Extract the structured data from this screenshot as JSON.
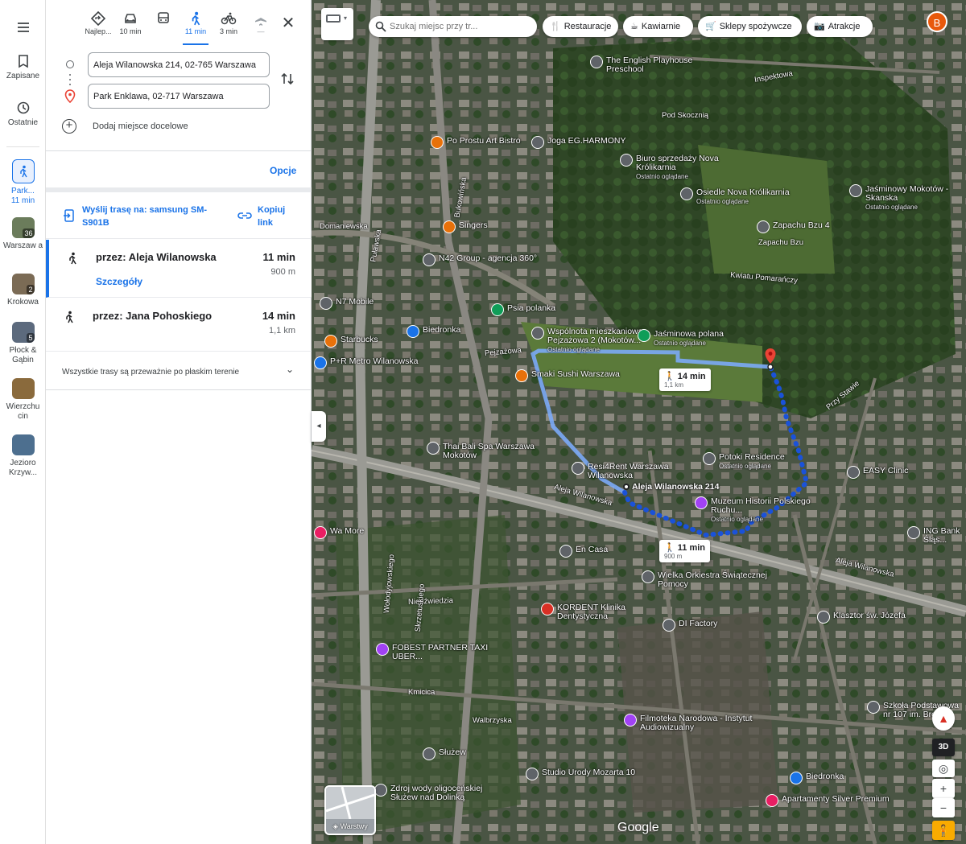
{
  "rail": {
    "menu_icon": "menu-icon",
    "saved_label": "Zapisane",
    "recent_label": "Ostatnie",
    "current": {
      "label": "Park...",
      "sub": "11 min"
    },
    "recents": [
      {
        "label": "Warszaw a",
        "badge": "36",
        "color": "#6b7c5b"
      },
      {
        "label": "Krokowa",
        "badge": "2",
        "color": "#7b6b55"
      },
      {
        "label": "Płock & Gąbin",
        "badge": "5",
        "color": "#5c6a7d"
      },
      {
        "label": "Wierzchu cin",
        "badge": "",
        "color": "#8a6a3c"
      },
      {
        "label": "Jezioro Krzyw...",
        "badge": "",
        "color": "#4d6f8f"
      }
    ]
  },
  "modes": [
    {
      "name": "best",
      "label": "Najlep...",
      "icon": "diamond-icon"
    },
    {
      "name": "car",
      "label": "10 min",
      "icon": "car-icon"
    },
    {
      "name": "transit",
      "label": "",
      "icon": "bus-icon"
    },
    {
      "name": "walk",
      "label": "11 min",
      "icon": "walk-icon",
      "active": true
    },
    {
      "name": "bike",
      "label": "3 min",
      "icon": "bike-icon"
    },
    {
      "name": "flight",
      "label": "—",
      "icon": "plane-icon"
    }
  ],
  "directions": {
    "origin": "Aleja Wilanowska 214, 02-765 Warszawa",
    "destination": "Park Enklawa, 02-717 Warszawa",
    "add_destination": "Dodaj miejsce docelowe",
    "options": "Opcje",
    "send_label": "Wyślij trasę na: samsung SM-S901B",
    "copy_label": "Kopiuj link",
    "routes": [
      {
        "name": "przez: Aleja Wilanowska",
        "time": "11 min",
        "distance": "900 m",
        "details": "Szczegóły"
      },
      {
        "name": "przez: Jana Pohoskiego",
        "time": "14 min",
        "distance": "1,1 km"
      }
    ],
    "terrain_note": "Wszystkie trasy są przeważnie po płaskim terenie"
  },
  "map": {
    "search_placeholder": "Szukaj miejsc przy tr...",
    "chips": [
      "Restauracje",
      "Kawiarnie",
      "Sklepy spożywcze",
      "Atrakcje"
    ],
    "avatar": "B",
    "layers_label": "Warstwy",
    "logo": "Google",
    "btn_3d": "3D",
    "zoom_in": "+",
    "zoom_out": "−",
    "bubble_alt": {
      "time": "14 min",
      "dist": "1,1 km"
    },
    "bubble_main": {
      "time": "11 min",
      "dist": "900 m"
    },
    "origin_label": "Aleja Wilanowska 214",
    "places": [
      {
        "name": "The English Playhouse Preschool",
        "sub": ""
      },
      {
        "name": "Po Prostu Art Bistro",
        "sub": ""
      },
      {
        "name": "Joga EG.HARMONY",
        "sub": ""
      },
      {
        "name": "Biuro sprzedaży Nova Królikarnia",
        "sub": "Ostatnio oglądane"
      },
      {
        "name": "Osiedle Nova Królikarnia",
        "sub": "Ostatnio oglądane"
      },
      {
        "name": "Jaśminowy Mokotów - Skanska",
        "sub": "Ostatnio oglądane"
      },
      {
        "name": "Singers",
        "sub": ""
      },
      {
        "name": "N42 Group - agencja 360°",
        "sub": ""
      },
      {
        "name": "Zapachu Bzu 4",
        "sub": ""
      },
      {
        "name": "N7 Mobile",
        "sub": ""
      },
      {
        "name": "Psia polanka",
        "sub": ""
      },
      {
        "name": "Biedronka",
        "sub": ""
      },
      {
        "name": "Wspólnota mieszkaniowa Pejzażowa 2 (Mokotów...",
        "sub": "Ostatnio oglądane"
      },
      {
        "name": "Jaśminowa polana",
        "sub": "Ostatnio oglądane"
      },
      {
        "name": "Starbucks",
        "sub": ""
      },
      {
        "name": "P+R Metro Wilanowska",
        "sub": ""
      },
      {
        "name": "Smaki Sushi Warszawa",
        "sub": ""
      },
      {
        "name": "Thai Bali Spa Warszawa Mokotów",
        "sub": ""
      },
      {
        "name": "Resi4Rent Warszawa Wilanowska",
        "sub": ""
      },
      {
        "name": "Potoki Residence",
        "sub": "Ostatnio oglądane"
      },
      {
        "name": "EASY Clinic",
        "sub": ""
      },
      {
        "name": "Muzeum Historii Polskiego Ruchu...",
        "sub": "Ostatnio oglądane"
      },
      {
        "name": "En Casa",
        "sub": ""
      },
      {
        "name": "Wielka Orkiestra Świątecznej Pomocy",
        "sub": ""
      },
      {
        "name": "KORDENT Klinika Dentystyczna",
        "sub": ""
      },
      {
        "name": "DI Factory",
        "sub": ""
      },
      {
        "name": "Klasztor św. Józefa",
        "sub": ""
      },
      {
        "name": "FOBEST PARTNER TAXI UBER...",
        "sub": ""
      },
      {
        "name": "Filmoteka Narodowa - Instytut Audiowizualny",
        "sub": ""
      },
      {
        "name": "Szkoła Podstawowa nr 107 im. Bron...",
        "sub": ""
      },
      {
        "name": "Studio Urody Mozarta 10",
        "sub": ""
      },
      {
        "name": "Biedronka",
        "sub": ""
      },
      {
        "name": "Apartamenty Silver Premium",
        "sub": ""
      },
      {
        "name": "ING Bank Śląs...",
        "sub": ""
      },
      {
        "name": "Wa More",
        "sub": ""
      },
      {
        "name": "Służew",
        "sub": ""
      },
      {
        "name": "Zdroj wody oligoceńskiej Służew nad Dolinką",
        "sub": ""
      }
    ],
    "streets": [
      "Aleja Wilanowska",
      "Aleja Wilanowska",
      "Puławska",
      "Bukowińska",
      "Domaniewska",
      "Niedźwiedzia",
      "Kmicica",
      "Walbrzyska",
      "Inspektowa",
      "Pod Skocznią",
      "Kwiatu Pomarańczy",
      "Pejzażowa",
      "Zapachu Bzu",
      "Przy Stawie",
      "Wołodyjowskiego",
      "Skrzetuskiego"
    ]
  }
}
